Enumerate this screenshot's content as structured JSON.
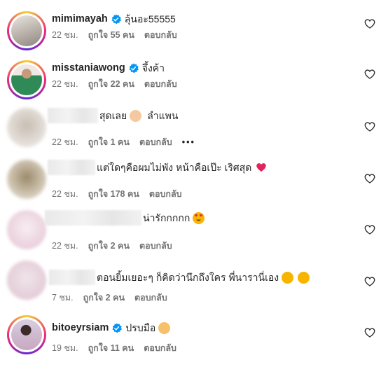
{
  "comments": [
    {
      "username": "mimimayah",
      "verified": true,
      "text": "ลุ้นอะ55555",
      "time": "22 ชม.",
      "likes": "ถูกใจ 55 คน",
      "reply": "ตอบกลับ",
      "avatar_color": "#c9c2bb",
      "icon": "heart-outline-icon"
    },
    {
      "username": "misstaniawong",
      "verified": true,
      "text": "จึ้งค้า",
      "time": "22 ชม.",
      "likes": "ถูกใจ 22 คน",
      "reply": "ตอบกลับ",
      "avatar_color": "#3f8a5c",
      "icon": "heart-outline-icon"
    },
    {
      "username": "",
      "verified": false,
      "text": "สุดเลย",
      "text2": "ลำแพน",
      "emoji": "clapping-hands-emoji",
      "time": "22 ชม.",
      "likes": "ถูกใจ 1 คน",
      "reply": "ตอบกลับ",
      "more": "•••",
      "avatar_color": "#d4ccc4",
      "icon": "heart-outline-icon"
    },
    {
      "username": "",
      "verified": false,
      "text": "แต่ใดๆคือผมไม่พัง หน้าคือเป๊ะ เริศสุด",
      "emoji": "red-heart-emoji",
      "time": "22 ชม.",
      "likes": "ถูกใจ 178 คน",
      "reply": "ตอบกลับ",
      "avatar_color": "#b9aa8e",
      "icon": "heart-outline-icon"
    },
    {
      "username": "",
      "verified": false,
      "text": "น่ารักกกกก",
      "emoji": "heart-eyes-emoji",
      "time": "22 ชม.",
      "likes": "ถูกใจ 2 คน",
      "reply": "ตอบกลับ",
      "avatar_color": "#f1dde6",
      "icon": "heart-outline-icon"
    },
    {
      "username": "",
      "verified": false,
      "text": "ตอนยิ้มเยอะๆ ก็คิดว่านึกถึงใคร พี่นารานี่เอง",
      "emoji": "grinning-sweat-emoji",
      "time": "7 ชม.",
      "likes": "ถูกใจ 2 คน",
      "reply": "ตอบกลับ",
      "avatar_color": "#e7d8df",
      "icon": "heart-outline-icon"
    },
    {
      "username": "bitoeyrsiam",
      "verified": true,
      "text": "ปรบมือ",
      "emoji": "clapping-hands-emoji",
      "time": "19 ชม.",
      "likes": "ถูกใจ 11 คน",
      "reply": "ตอบกลับ",
      "avatar_color": "#d9c7d9",
      "icon": "heart-outline-icon"
    }
  ]
}
